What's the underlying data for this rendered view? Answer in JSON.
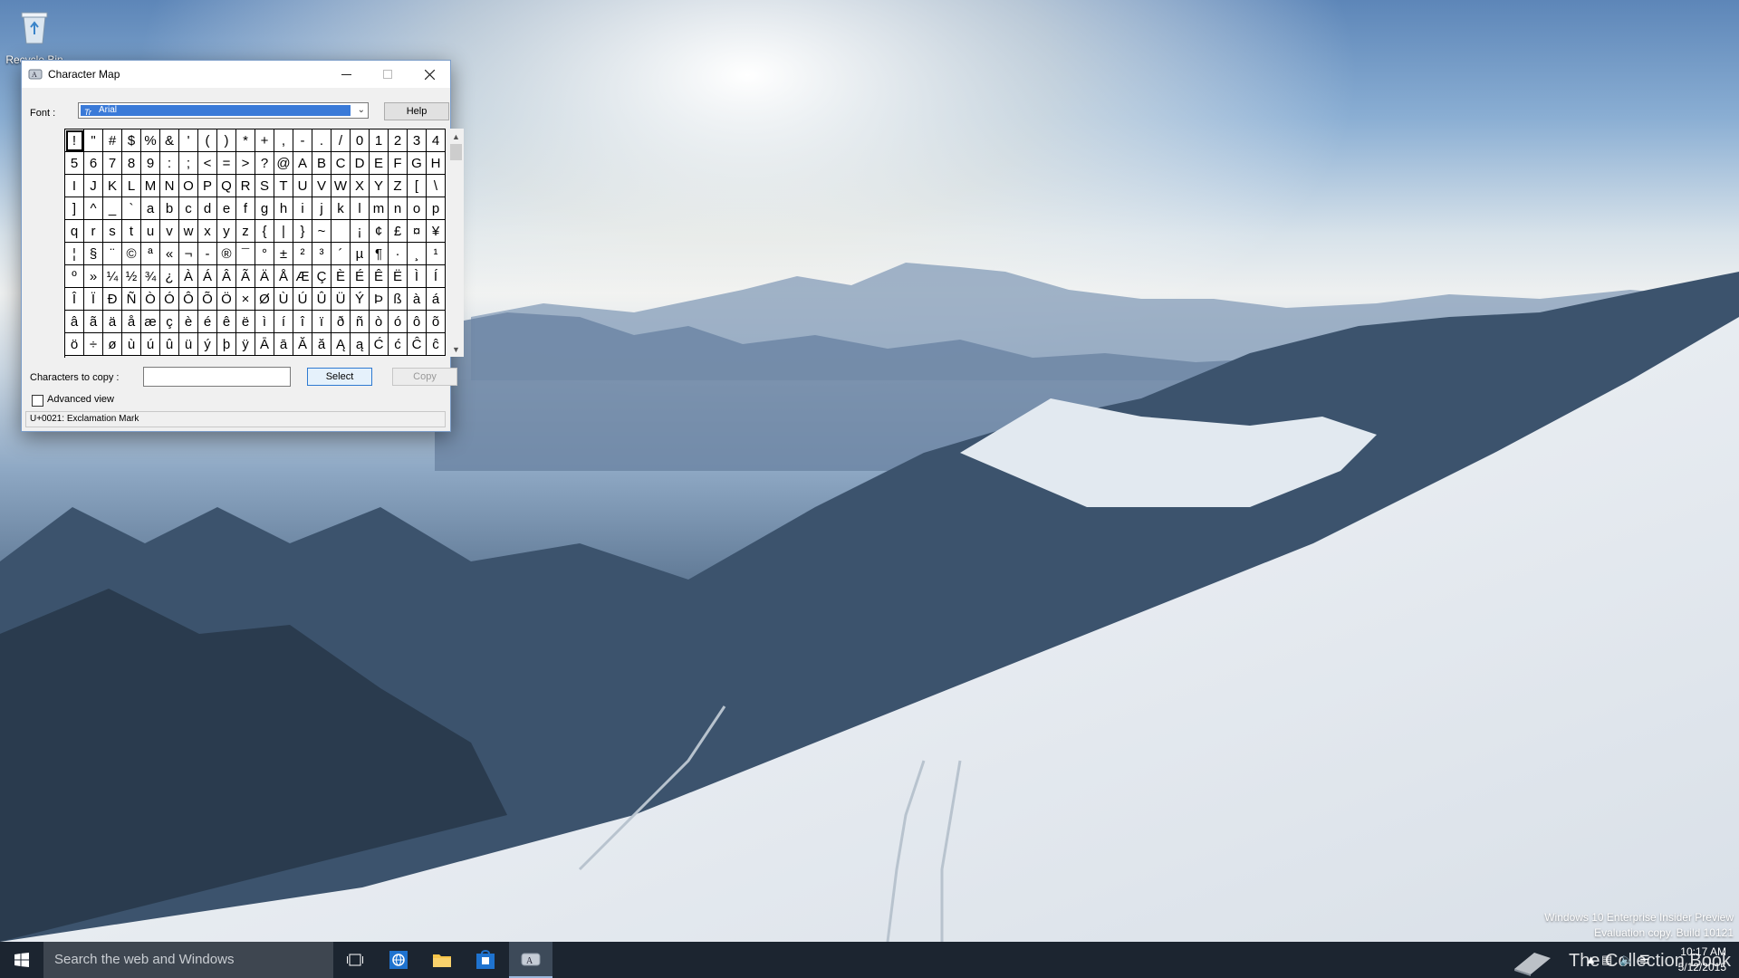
{
  "desktop": {
    "recycle_bin_label": "Recycle Bin"
  },
  "window": {
    "title": "Character Map",
    "icon": "charmap-app-icon",
    "controls": {
      "minimize": "–",
      "maximize": "☐",
      "close": "✕"
    }
  },
  "font": {
    "label": "Font :",
    "value": "Arial",
    "help_label": "Help"
  },
  "grid": {
    "selected_index": 0,
    "characters": [
      "!",
      "\"",
      "#",
      "$",
      "%",
      "&",
      "'",
      "(",
      ")",
      "*",
      "+",
      ",",
      "-",
      ".",
      "/",
      "0",
      "1",
      "2",
      "3",
      "4",
      "5",
      "6",
      "7",
      "8",
      "9",
      ":",
      ";",
      "<",
      "=",
      ">",
      "?",
      "@",
      "A",
      "B",
      "C",
      "D",
      "E",
      "F",
      "G",
      "H",
      "I",
      "J",
      "K",
      "L",
      "M",
      "N",
      "O",
      "P",
      "Q",
      "R",
      "S",
      "T",
      "U",
      "V",
      "W",
      "X",
      "Y",
      "Z",
      "[",
      "\\",
      "]",
      "^",
      "_",
      "`",
      "a",
      "b",
      "c",
      "d",
      "e",
      "f",
      "g",
      "h",
      "i",
      "j",
      "k",
      "l",
      "m",
      "n",
      "o",
      "p",
      "q",
      "r",
      "s",
      "t",
      "u",
      "v",
      "w",
      "x",
      "y",
      "z",
      "{",
      "|",
      "}",
      "~",
      " ",
      "¡",
      "¢",
      "£",
      "¤",
      "¥",
      "¦",
      "§",
      "¨",
      "©",
      "ª",
      "«",
      "¬",
      "-",
      "®",
      "¯",
      "°",
      "±",
      "²",
      "³",
      "´",
      "µ",
      "¶",
      "·",
      "¸",
      "¹",
      "º",
      "»",
      "¼",
      "½",
      "¾",
      "¿",
      "À",
      "Á",
      "Â",
      "Ã",
      "Ä",
      "Å",
      "Æ",
      "Ç",
      "È",
      "É",
      "Ê",
      "Ë",
      "Ì",
      "Í",
      "Î",
      "Ï",
      "Ð",
      "Ñ",
      "Ò",
      "Ó",
      "Ô",
      "Õ",
      "Ö",
      "×",
      "Ø",
      "Ù",
      "Ú",
      "Û",
      "Ü",
      "Ý",
      "Þ",
      "ß",
      "à",
      "á",
      "â",
      "ã",
      "ä",
      "å",
      "æ",
      "ç",
      "è",
      "é",
      "ê",
      "ë",
      "ì",
      "í",
      "î",
      "ï",
      "ð",
      "ñ",
      "ò",
      "ó",
      "ô",
      "õ",
      "ö",
      "÷",
      "ø",
      "ù",
      "ú",
      "û",
      "ü",
      "ý",
      "þ",
      "ÿ",
      "Ā",
      "ā",
      "Ă",
      "ă",
      "Ą",
      "ą",
      "Ć",
      "ć",
      "Ĉ",
      "ĉ"
    ]
  },
  "copy": {
    "label": "Characters to copy :",
    "value": "",
    "select_label": "Select",
    "copy_label": "Copy"
  },
  "advanced": {
    "label": "Advanced view",
    "checked": false
  },
  "status": {
    "text": "U+0021: Exclamation Mark"
  },
  "watermark": {
    "line1": "Windows 10 Enterprise Insider Preview",
    "line2": "Evaluation copy. Build 10121"
  },
  "taskbar": {
    "search_placeholder": "Search the web and Windows",
    "brand_text": "The Collection Book",
    "time": "10:17 AM",
    "date": "5/12/2015",
    "colors": {
      "background": "#1c2530",
      "search": "#3e4650",
      "accent": "#3a7ad8"
    }
  }
}
